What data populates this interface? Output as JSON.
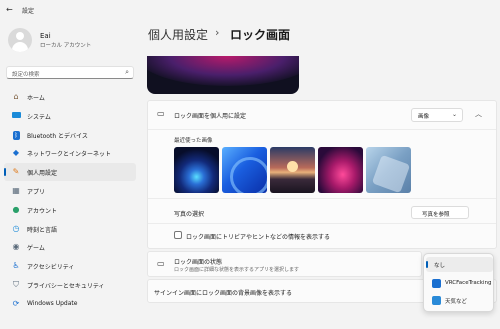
{
  "window": {
    "title": "設定"
  },
  "user": {
    "name": "Eai",
    "account": "ローカル アカウント"
  },
  "search": {
    "placeholder": "設定の検索"
  },
  "sidebar": {
    "items": [
      {
        "label": "ホーム",
        "icon": "home-icon"
      },
      {
        "label": "システム",
        "icon": "system-icon"
      },
      {
        "label": "Bluetooth とデバイス",
        "icon": "bluetooth-icon"
      },
      {
        "label": "ネットワークとインターネット",
        "icon": "network-icon"
      },
      {
        "label": "個人用設定",
        "icon": "brush-icon",
        "active": true
      },
      {
        "label": "アプリ",
        "icon": "apps-icon"
      },
      {
        "label": "アカウント",
        "icon": "account-icon"
      },
      {
        "label": "時刻と言語",
        "icon": "clock-globe-icon"
      },
      {
        "label": "ゲーム",
        "icon": "game-controller-icon"
      },
      {
        "label": "アクセシビリティ",
        "icon": "accessibility-icon"
      },
      {
        "label": "プライバシーとセキュリティ",
        "icon": "shield-icon"
      },
      {
        "label": "Windows Update",
        "icon": "update-icon"
      }
    ]
  },
  "breadcrumb": {
    "parent": "個人用設定",
    "separator": "›",
    "current": "ロック画面"
  },
  "lock_screen": {
    "personalize_label": "ロック画面を個人用に設定",
    "personalize_value": "画像",
    "recent_images_label": "最近使った画像",
    "choose_photo_label": "写真の選択",
    "browse_button": "写真を参照",
    "fun_facts_label": "ロック画面にトリビアやヒントなどの情報を表示する"
  },
  "status": {
    "label": "ロック画面の状態",
    "description": "ロック画面に詳細な状態を表示するアプリを選択します"
  },
  "signin": {
    "label": "サインイン画面にロック画面の背景画像を表示する"
  },
  "status_dropdown": {
    "options": [
      {
        "label": "なし",
        "selected": true
      },
      {
        "label": "VRCFaceTracking",
        "icon": "vrcfacetracking-app-icon"
      },
      {
        "label": "天気など",
        "icon": "weather-app-icon"
      }
    ]
  },
  "colors": {
    "accent": "#005fb8",
    "background": "#f3f3f3",
    "card": "#fbfbfb"
  }
}
